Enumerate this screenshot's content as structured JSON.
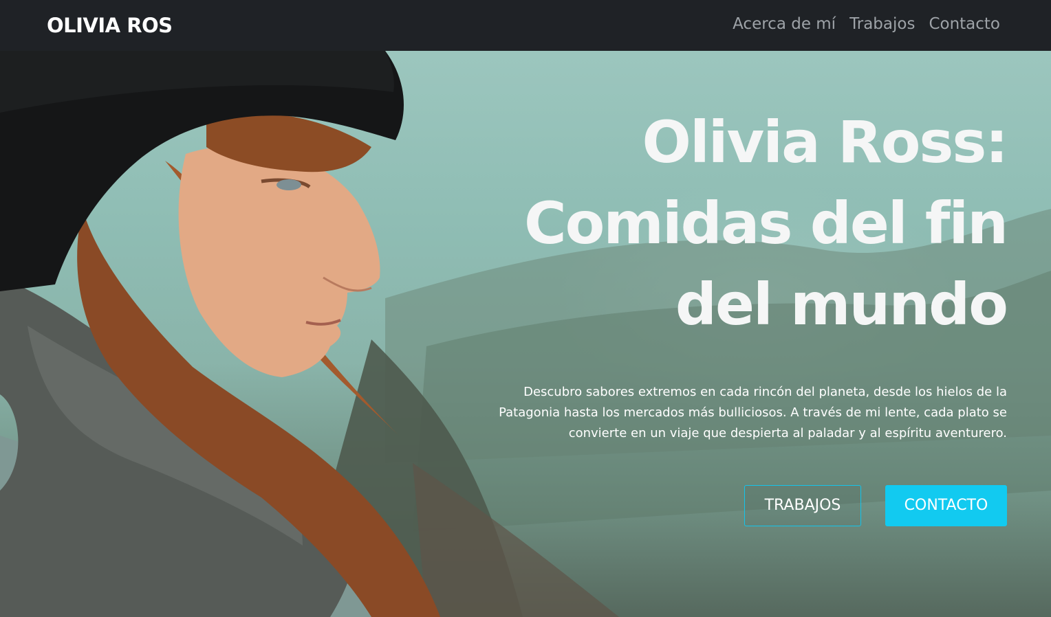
{
  "navbar": {
    "brand": "OLIVIA ROS",
    "links": [
      "Acerca de mí",
      "Trabajos",
      "Contacto"
    ]
  },
  "hero": {
    "title_lines": [
      "Olivia Ross:",
      "Comidas del fin",
      "del mundo"
    ],
    "description": "Descubro sabores extremos en cada rincón del planeta, desde los hielos de la Patagonia hasta los mercados más bulliciosos. A través de mi lente, cada plato se convierte en un viaje que despierta al paladar y al espíritu aventurero.",
    "buttons": {
      "primary_outline": "TRABAJOS",
      "primary_solid": "CONTACTO"
    }
  },
  "colors": {
    "navbar_bg": "#1f2226",
    "nav_link": "#9ea3a8",
    "accent": "#12caf0",
    "hero_sky": "#9cc6be"
  }
}
